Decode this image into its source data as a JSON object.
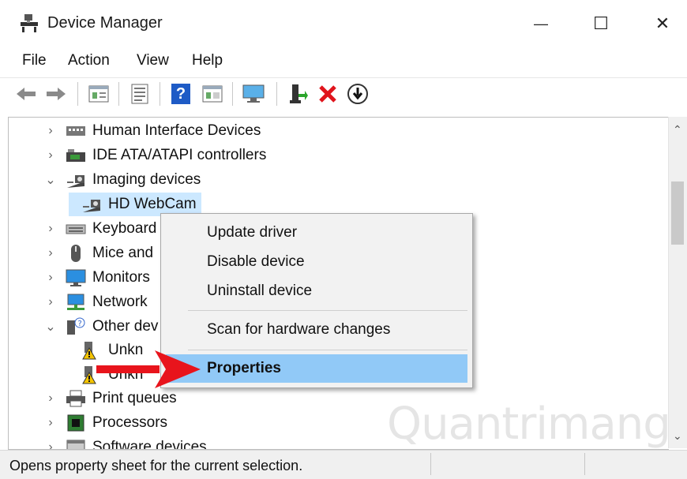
{
  "window": {
    "title": "Device Manager",
    "minimize_glyph": "—",
    "maximize_glyph": "☐",
    "close_glyph": "✕"
  },
  "menu": [
    "File",
    "Action",
    "View",
    "Help"
  ],
  "toolbar": {
    "icons": [
      "back-arrow-icon",
      "forward-arrow-icon",
      "properties-icon",
      "device-list-icon",
      "help-icon",
      "resources-icon",
      "monitor-scan-icon",
      "update-driver-icon",
      "uninstall-icon",
      "disable-icon"
    ],
    "help_glyph": "?"
  },
  "tree": {
    "rows": [
      {
        "label": "Human Interface Devices",
        "expander": "›",
        "icon": "hid-icon"
      },
      {
        "label": "IDE ATA/ATAPI controllers",
        "expander": "›",
        "icon": "ide-controller-icon"
      },
      {
        "label": "Imaging devices",
        "expander": "⌄",
        "icon": "camera-icon"
      },
      {
        "label": "HD WebCam",
        "expander": "",
        "icon": "camera-icon",
        "selected": true
      },
      {
        "label": "Keyboard",
        "expander": "›",
        "icon": "keyboard-icon"
      },
      {
        "label": "Mice and",
        "expander": "›",
        "icon": "mouse-icon"
      },
      {
        "label": "Monitors",
        "expander": "›",
        "icon": "monitor-icon"
      },
      {
        "label": "Network",
        "expander": "›",
        "icon": "network-icon"
      },
      {
        "label": "Other dev",
        "expander": "⌄",
        "icon": "unknown-device-icon"
      },
      {
        "label": "Unkn",
        "expander": "",
        "icon": "warning-device-icon"
      },
      {
        "label": "Unkn",
        "expander": "",
        "icon": "warning-device-icon"
      },
      {
        "label": "Print queues",
        "expander": "›",
        "icon": "printer-icon"
      },
      {
        "label": "Processors",
        "expander": "›",
        "icon": "processor-icon"
      },
      {
        "label": "Software devices",
        "expander": "›",
        "icon": "software-icon"
      }
    ]
  },
  "context_menu": {
    "items": [
      "Update driver",
      "Disable device",
      "Uninstall device",
      "Scan for hardware changes",
      "Properties"
    ],
    "highlighted": "Properties"
  },
  "status_bar": {
    "text": "Opens property sheet for the current selection."
  },
  "watermark": "Quantrimang",
  "colors": {
    "selection": "#cce8ff",
    "highlight": "#91c9f7",
    "arrow": "#e8141c"
  }
}
